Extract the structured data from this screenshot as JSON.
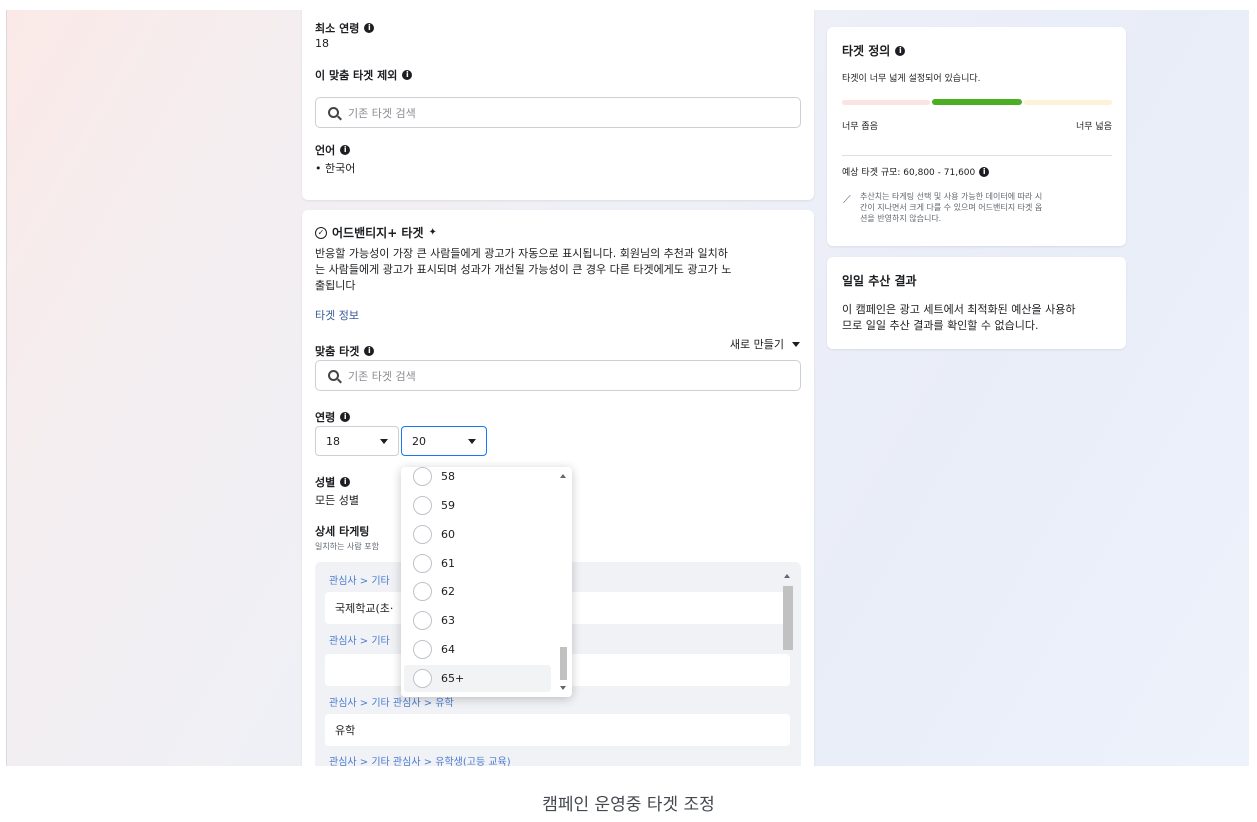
{
  "top_card": {
    "min_age_label": "최소 연령",
    "min_age_value": "18",
    "exclude_label": "이 맞춤 타겟 제외",
    "exclude_search_placeholder": "기존 타겟 검색",
    "language_label": "언어",
    "language_value": "한국어"
  },
  "adv_card": {
    "title": "어드밴티지+ 타겟",
    "description_lines": [
      "반응할 가능성이 가장 큰 사람들에게 광고가 자동으로 표시됩니다. 회원님의 추천과 일치하",
      "는 사람들에게 광고가 표시되며 성과가 개선될 가능성이 큰 경우 다른 타겟에게도 광고가 노",
      "출됩니다"
    ],
    "target_info_link": "타겟 정보",
    "custom_audience_label": "맞춤 타겟",
    "create_new_label": "새로 만들기",
    "custom_search_placeholder": "기존 타겟 검색",
    "age_label": "연령",
    "age_min": "18",
    "age_max": "20",
    "gender_label": "성별",
    "gender_value": "모든 성별",
    "detailed_label": "상세 타게팅",
    "detailed_sub": "일치하는 사람 포함",
    "targeting": {
      "row1_path": "관심사 > 기타",
      "row1_value": "국제학교(초·",
      "row2_path": "관심사 > 기타",
      "row2_value": "",
      "row3_path": "관심사 > 기타 관심사 > 유학",
      "row3_value": "유학",
      "row4_path": "관심사 > 기타 관심사 > 유학생(고등 교육)"
    }
  },
  "age_dropdown": {
    "options": [
      "58",
      "59",
      "60",
      "61",
      "62",
      "63",
      "64",
      "65+"
    ],
    "hovered": "65+"
  },
  "definition_card": {
    "title": "타겟 정의",
    "status": "타겟이 너무 넓게 설정되어 있습니다.",
    "narrow_label": "너무 좁음",
    "broad_label": "너무 넓음",
    "estimate_label": "예상 타겟 규모: 60,800 - 71,600",
    "note_lines": [
      "추산치는 타게팅 선택 및 사용 가능한 데이터에 따라 시",
      "간이 지나면서 크게 다를 수 있으며 어드밴티지 타겟 옵",
      "션을 반영하지 않습니다."
    ],
    "colors": {
      "narrow": "#fbe3e3",
      "good": "#4caf22",
      "broad": "#fdf1d7"
    }
  },
  "daily_card": {
    "title": "일일 추산 결과",
    "body_lines": [
      "이 캠페인은 광고 세트에서 최적화된 예산을 사용하",
      "므로 일일 추산 결과를 확인할 수 없습니다."
    ]
  },
  "caption": "캠페인 운영중 타겟 조정"
}
